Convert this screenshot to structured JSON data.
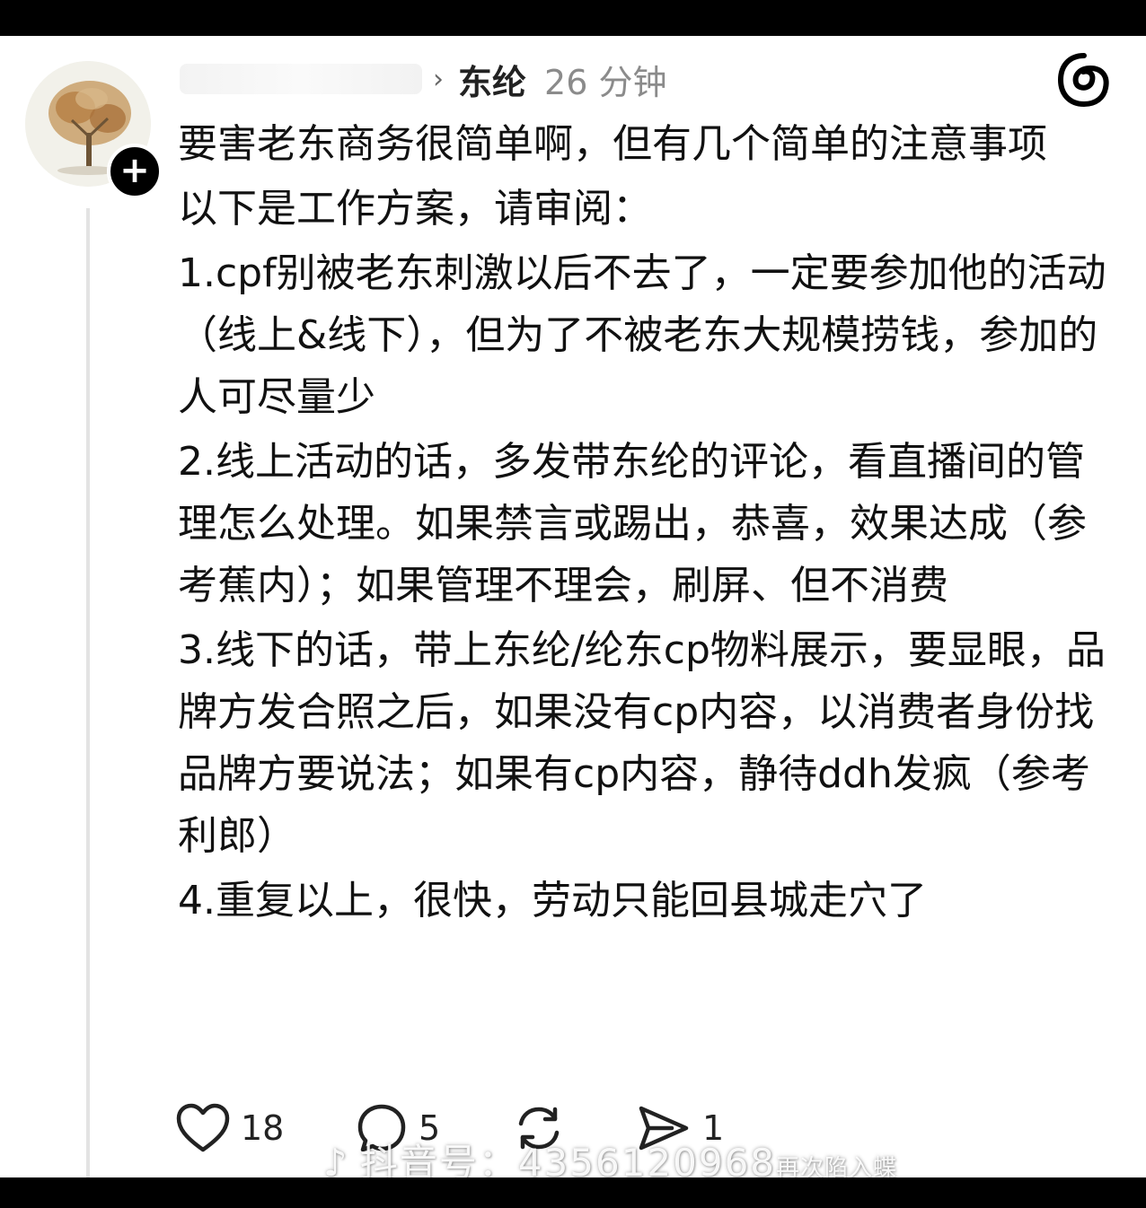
{
  "post": {
    "author_tag": "东纶",
    "time": "26 分钟",
    "paragraphs": [
      "要害老东商务很简单啊，但有几个简单的注意事项",
      "以下是工作方案，请审阅：",
      "1.cpf别被老东刺激以后不去了，一定要参加他的活动（线上&线下），但为了不被老东大规模捞钱，参加的人可尽量少",
      "2.线上活动的话，多发带东纶的评论，看直播间的管理怎么处理。如果禁言或踢出，恭喜，效果达成（参考蕉内）；如果管理不理会，刷屏、但不消费",
      "3.线下的话，带上东纶/纶东cp物料展示，要显眼，品牌方发合照之后，如果没有cp内容，以消费者身份找品牌方要说法；如果有cp内容，静待ddh发疯（参考利郎）",
      "4.重复以上，很快，劳动只能回县城走穴了"
    ]
  },
  "actions": {
    "likes": "18",
    "replies": "5",
    "reposts": "",
    "shares": "1"
  },
  "icons": {
    "header_logo": "threads-logo-icon",
    "avatar": "tree-avatar",
    "follow": "plus-icon",
    "like": "heart-icon",
    "reply": "comment-bubble-icon",
    "repost": "repost-icon",
    "share": "send-icon"
  },
  "watermark": {
    "text": "抖音号：4356120968",
    "sub": "再次陷入蝶"
  }
}
